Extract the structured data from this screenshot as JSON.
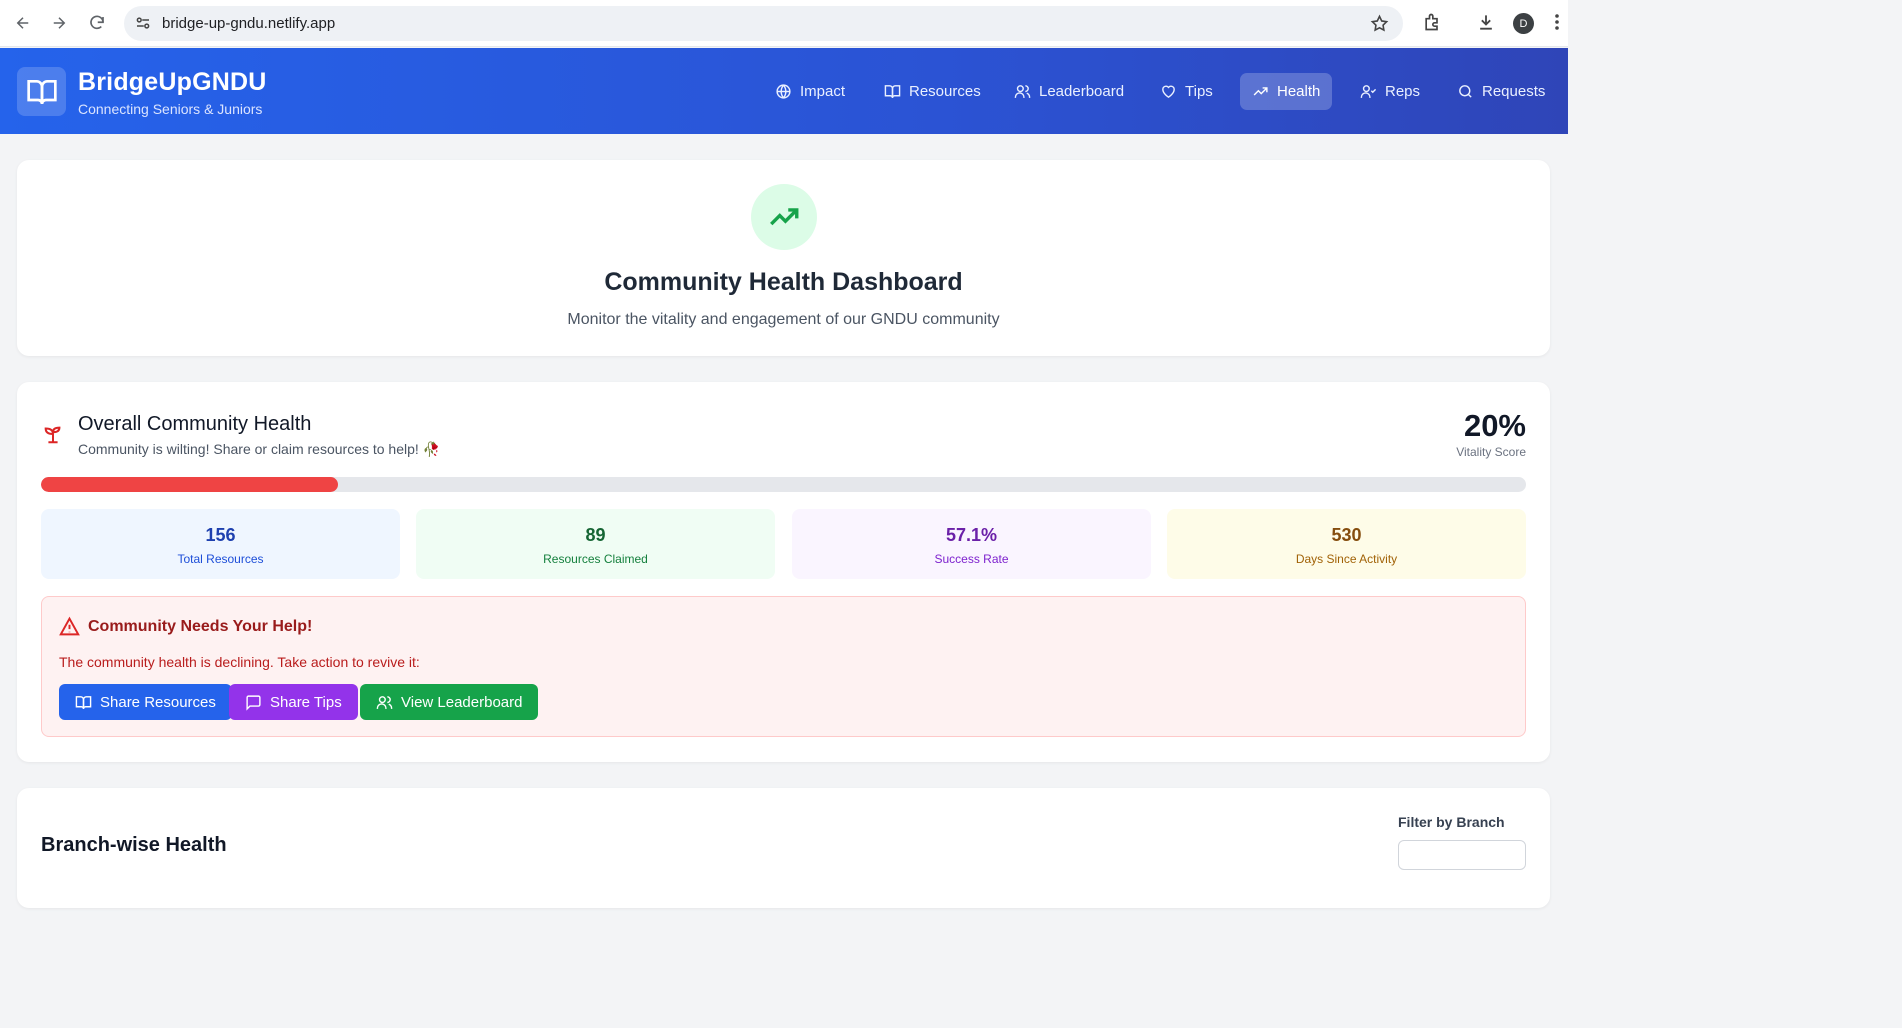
{
  "browser": {
    "url": "bridge-up-gndu.netlify.app",
    "avatar_letter": "D"
  },
  "header": {
    "brand_title": "BridgeUpGNDU",
    "brand_subtitle": "Connecting Seniors & Juniors",
    "nav": [
      {
        "label": "Impact",
        "icon": "globe-icon"
      },
      {
        "label": "Resources",
        "icon": "book-icon"
      },
      {
        "label": "Leaderboard",
        "icon": "users-icon"
      },
      {
        "label": "Tips",
        "icon": "heart-icon"
      },
      {
        "label": "Health",
        "icon": "trending-up-icon",
        "active": true
      },
      {
        "label": "Reps",
        "icon": "user-check-icon"
      },
      {
        "label": "Requests",
        "icon": "search-icon"
      }
    ]
  },
  "hero": {
    "title": "Community Health Dashboard",
    "subtitle": "Monitor the vitality and engagement of our GNDU community"
  },
  "health": {
    "title": "Overall Community Health",
    "subtitle": "Community is wilting! Share or claim resources to help! 🥀",
    "vitality_score": "20%",
    "vitality_label": "Vitality Score",
    "vitality_fraction": 0.2,
    "bar_color": "#ef4444",
    "stats": [
      {
        "value": "156",
        "label": "Total Resources",
        "color": "blue"
      },
      {
        "value": "89",
        "label": "Resources Claimed",
        "color": "green"
      },
      {
        "value": "57.1%",
        "label": "Success Rate",
        "color": "purple"
      },
      {
        "value": "530",
        "label": "Days Since Activity",
        "color": "yellow"
      }
    ],
    "alert": {
      "title": "Community Needs Your Help!",
      "text": "The community health is declining. Take action to revive it:",
      "buttons": [
        {
          "label": "Share Resources",
          "color": "#2563eb",
          "icon": "book-icon"
        },
        {
          "label": "Share Tips",
          "color": "#9333ea",
          "icon": "message-square-icon"
        },
        {
          "label": "View Leaderboard",
          "color": "#16a34a",
          "icon": "users-icon"
        }
      ]
    }
  },
  "branch": {
    "title": "Branch-wise Health",
    "filter_label": "Filter by Branch"
  }
}
